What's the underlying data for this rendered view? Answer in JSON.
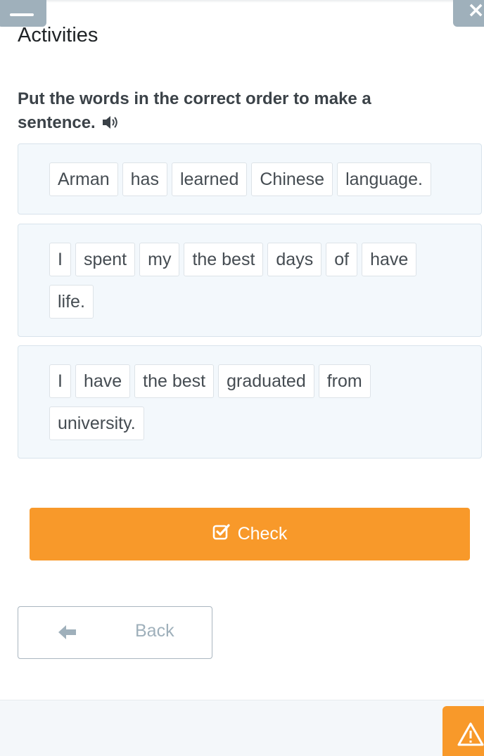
{
  "header": {
    "section_title": "Activities",
    "menu_icon": "hamburger-icon",
    "close_icon": "close-icon"
  },
  "task": {
    "instruction": "Put the words in the correct order to make a sentence.",
    "audio_icon": "speaker-icon"
  },
  "sentences": [
    {
      "words": [
        "Arman",
        "has",
        "learned",
        "Chinese",
        "language."
      ]
    },
    {
      "words": [
        "I",
        "spent",
        "my",
        "the best",
        "days",
        "of",
        "have",
        "life."
      ]
    },
    {
      "words": [
        "I",
        "have",
        "the best",
        "graduated",
        "from",
        "university."
      ]
    }
  ],
  "actions": {
    "check_label": "Check",
    "check_icon": "checkbox-icon",
    "back_label": "Back",
    "back_icon": "arrow-left-icon",
    "report_icon": "warning-icon"
  },
  "colors": {
    "accent": "#f8992a",
    "muted": "#9fb0bb",
    "box_bg": "#f3f8fc"
  }
}
